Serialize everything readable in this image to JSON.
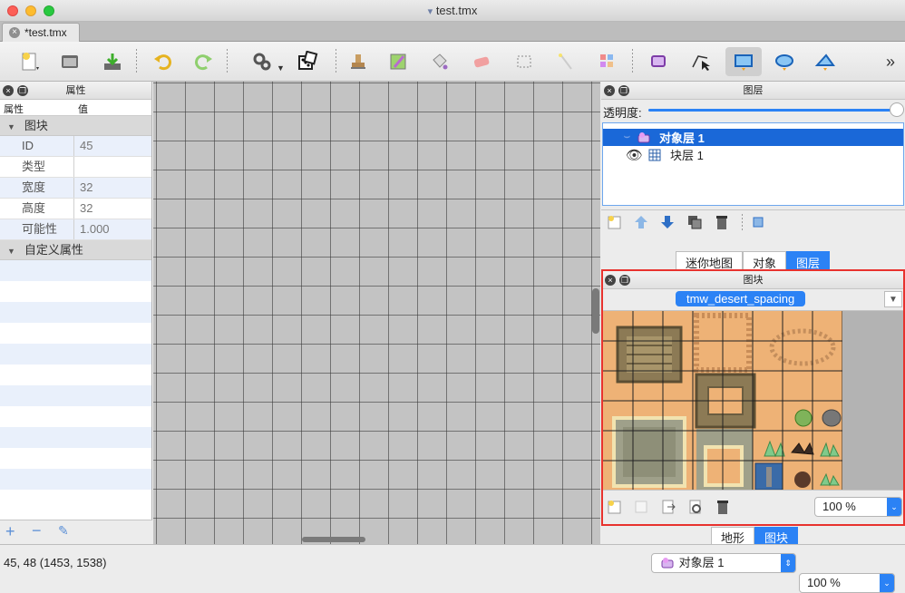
{
  "window": {
    "title": "test.tmx"
  },
  "tabs": [
    {
      "label": "*test.tmx"
    }
  ],
  "properties_panel": {
    "title": "属性",
    "col_property": "属性",
    "col_value": "值",
    "group_tile": "图块",
    "rows": [
      {
        "key": "ID",
        "value": "45"
      },
      {
        "key": "类型",
        "value": ""
      },
      {
        "key": "宽度",
        "value": "32"
      },
      {
        "key": "高度",
        "value": "32"
      },
      {
        "key": "可能性",
        "value": "1.000"
      }
    ],
    "group_custom": "自定义属性"
  },
  "layers_panel": {
    "title": "图层",
    "opacity_label": "透明度:",
    "layers": [
      {
        "name": "对象层 1",
        "type": "object"
      },
      {
        "name": "块层 1",
        "type": "tile"
      }
    ],
    "tabs": [
      "迷你地图",
      "对象",
      "图层"
    ],
    "active_tab": "图层"
  },
  "tileset_panel": {
    "title": "图块",
    "tileset_name": "tmw_desert_spacing",
    "zoom": "100 %",
    "tabs": [
      "地形",
      "图块"
    ],
    "active_tab": "图块"
  },
  "status": {
    "coords": "45, 48 (1453, 1538)",
    "current_layer": "对象层 1",
    "zoom": "100 %"
  },
  "colors": {
    "accent": "#2b82f5",
    "selection": "#1a68d8",
    "highlight_border": "#e8322e",
    "sand": "#eeb276"
  }
}
